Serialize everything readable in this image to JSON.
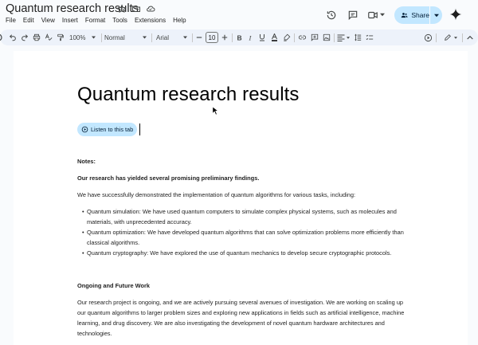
{
  "header": {
    "doc_title": "Quantum research results",
    "menu": [
      "File",
      "Edit",
      "View",
      "Insert",
      "Format",
      "Tools",
      "Extensions",
      "Help"
    ],
    "share_label": "Share",
    "accent_color": "#c2e7ff"
  },
  "toolbar": {
    "zoom": "100%",
    "style": "Normal",
    "font": "Arial",
    "font_size": "10"
  },
  "document": {
    "title": "Quantum research results",
    "listen_label": "Listen to this tab",
    "notes_heading": "Notes:",
    "findings_heading": "Our research has yielded several promising preliminary findings.",
    "intro": "We have successfully demonstrated the implementation of quantum algorithms for various tasks, including:",
    "bullets": [
      {
        "line1": "Quantum simulation: We have used quantum computers to simulate complex physical systems, such as molecules and",
        "line2": "materials, with unprecedented accuracy."
      },
      {
        "line1": "Quantum optimization: We have developed quantum algorithms that can solve optimization problems more efficiently than",
        "line2": "classical algorithms."
      },
      {
        "line1": "Quantum cryptography: We have explored the use of quantum mechanics to develop secure cryptographic protocols.",
        "line2": ""
      }
    ],
    "future_heading": "Ongoing and Future Work",
    "future_lines": [
      "Our research project is ongoing, and we are actively pursuing several avenues of investigation. We are working on scaling up",
      "our quantum algorithms to larger problem sizes and exploring new applications in fields such as artificial intelligence, machine",
      "learning, and drug discovery. We are also investigating the development of novel quantum hardware architectures and",
      "technologies."
    ]
  }
}
